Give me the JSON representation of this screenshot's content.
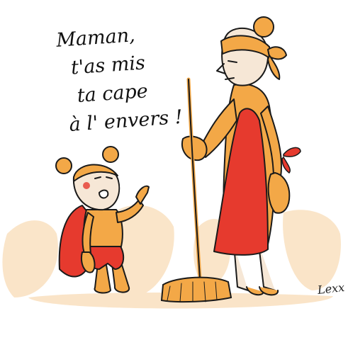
{
  "speech": {
    "line1": "Maman,",
    "line2": "t'as mis",
    "line3": "ta cape",
    "line4": "à l' envers !"
  },
  "signature": "Lexx",
  "colors": {
    "orange": "#f3a847",
    "orange_light": "#f7c98b",
    "red": "#e63a2e",
    "skin": "#f6e7d6",
    "ink": "#1a1a1a",
    "floor_wash": "#f6cf9c"
  },
  "icons": [
    "broom-icon",
    "bow-icon"
  ]
}
